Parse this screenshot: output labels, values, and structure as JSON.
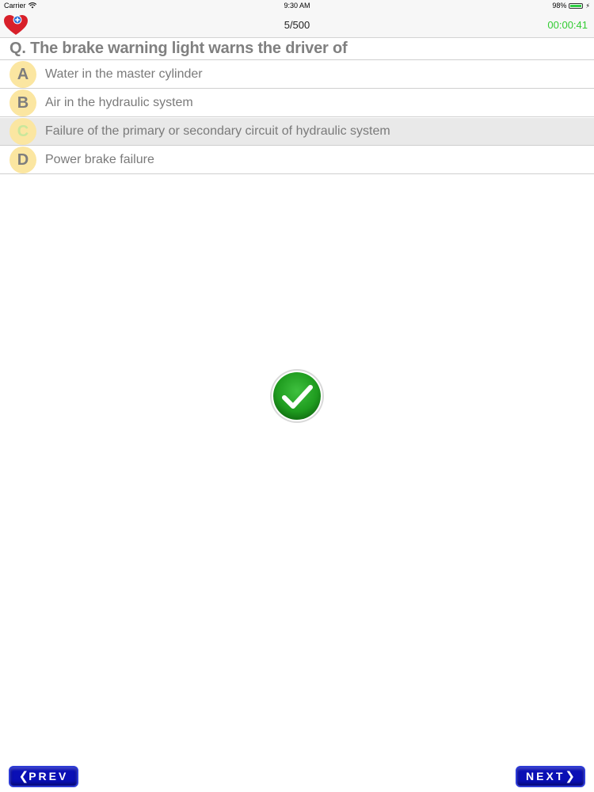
{
  "status_bar": {
    "carrier": "Carrier",
    "time": "9:30 AM",
    "battery": "98%",
    "battery_level": 0.98
  },
  "nav": {
    "progress": "5/500",
    "timer": "00:00:41",
    "timer_color": "#33cc33"
  },
  "question": {
    "text": "Q. The brake warning light warns the driver of"
  },
  "options": [
    {
      "letter": "A",
      "text": "Water in the master cylinder",
      "selected": false
    },
    {
      "letter": "B",
      "text": "Air in the hydraulic system",
      "selected": false
    },
    {
      "letter": "C",
      "text": "Failure of the primary or secondary circuit of hydraulic system",
      "selected": true
    },
    {
      "letter": "D",
      "text": "Power brake failure",
      "selected": false
    }
  ],
  "result": {
    "icon": "checkmark-correct-icon",
    "color": "#1f9c1f"
  },
  "footer": {
    "prev_label": "PREV",
    "next_label": "NEXT",
    "button_color": "#0a0fb5"
  }
}
